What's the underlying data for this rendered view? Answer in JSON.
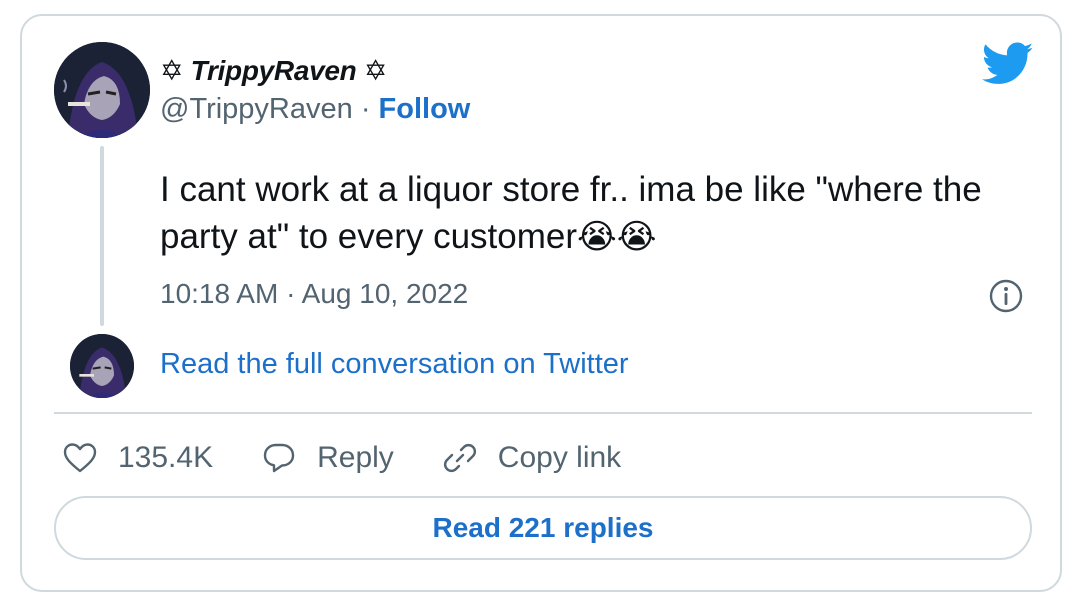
{
  "author": {
    "display_name": "✡ TrippyRaven ✡",
    "handle": "@TrippyRaven",
    "separator": " · ",
    "follow_label": "Follow"
  },
  "tweet": {
    "text": "I cant work at a liquor store fr.. ima be like \"where the party at\" to every customer",
    "emoji": "😭😭",
    "timestamp": "10:18 AM · Aug 10, 2022"
  },
  "conversation": {
    "read_full_label": "Read the full conversation on Twitter"
  },
  "actions": {
    "likes_count": "135.4K",
    "reply_label": "Reply",
    "copy_link_label": "Copy link"
  },
  "replies": {
    "read_replies_label": "Read 221 replies"
  },
  "colors": {
    "link_blue": "#1d70c9",
    "twitter_blue": "#1d9bf0",
    "muted_text": "#536471",
    "border": "#cfd9de"
  },
  "icons": [
    "twitter-bird-icon",
    "info-icon",
    "heart-icon",
    "reply-bubble-icon",
    "link-icon"
  ]
}
